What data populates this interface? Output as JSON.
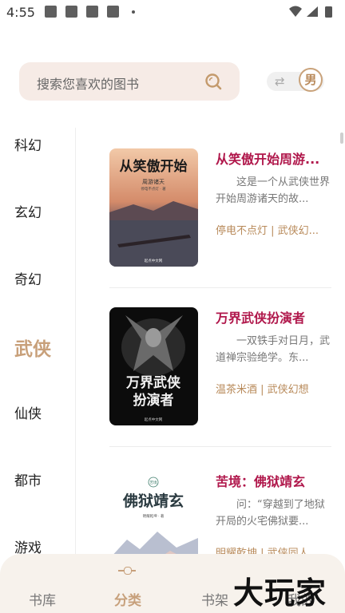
{
  "status_bar": {
    "time": "4:55"
  },
  "search": {
    "placeholder": "搜索您喜欢的图书"
  },
  "gender": {
    "selected": "男"
  },
  "categories": [
    "科幻",
    "玄幻",
    "奇幻",
    "武侠",
    "仙侠",
    "都市",
    "游戏"
  ],
  "active_category": "武侠",
  "books": [
    {
      "title": "从笑傲开始周游...",
      "description": "这是一个从武侠世界开始周游诸天的故...",
      "meta": "停电不点灯 | 武侠幻...",
      "cover": {
        "title": "从笑傲开始",
        "subtitle": "周游诸天",
        "author": "停电不点灯 · 著",
        "publisher": "起点中文网"
      }
    },
    {
      "title": "万界武侠扮演者",
      "description": "一双铁手对日月，武道禅宗验绝学。东...",
      "meta": "温茶米酒 | 武侠幻想",
      "cover": {
        "title": "万界武侠",
        "subtitle": "扮演者",
        "publisher": "起点中文网"
      }
    },
    {
      "title": "苦境：佛狱靖玄",
      "description": "问：“穿越到了地狱开局的火宅佛狱要...",
      "meta": "明耀乾坤 | 武侠同人",
      "cover": {
        "title": "佛狱靖玄",
        "subtitle": "苦境",
        "author": "明耀乾坤 · 著"
      }
    }
  ],
  "tabs": [
    "书库",
    "分类",
    "书架",
    "我的"
  ],
  "active_tab": "分类",
  "watermark": "大玩家"
}
